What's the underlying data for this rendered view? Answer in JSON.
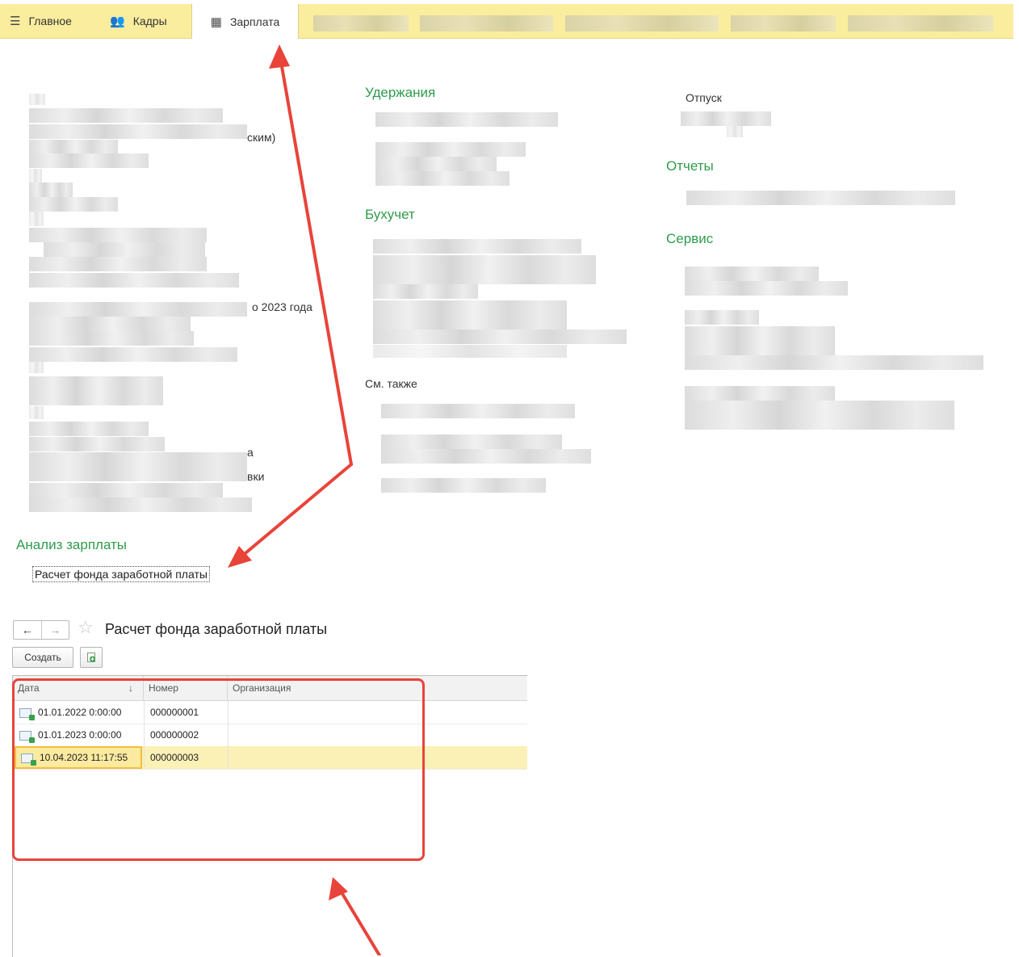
{
  "topbar": {
    "tabs": [
      {
        "label": "Главное",
        "icon": "menu-icon"
      },
      {
        "label": "Кадры",
        "icon": "people-icon"
      },
      {
        "label": "Зарплата",
        "icon": "calculator-icon",
        "active": true
      }
    ]
  },
  "left_fragments": {
    "frag1": "ским)",
    "frag2": "о 2023 года",
    "frag3": "а",
    "frag4": "вки"
  },
  "sections": {
    "deductions": "Удержания",
    "accounting": "Бухучет",
    "see_also": "См. также",
    "vacation": "Отпуск",
    "reports": "Отчеты",
    "service": "Сервис",
    "salary_analysis": "Анализ зарплаты",
    "salary_fund_link": "Расчет фонда заработной платы"
  },
  "form": {
    "title": "Расчет фонда заработной платы",
    "back": "←",
    "forward": "→",
    "create_label": "Создать"
  },
  "table": {
    "columns": [
      "Дата",
      "Номер",
      "Организация"
    ],
    "sort_indicator": "↓",
    "rows": [
      {
        "date": "01.01.2022 0:00:00",
        "number": "000000001",
        "org": ""
      },
      {
        "date": "01.01.2023 0:00:00",
        "number": "000000002",
        "org": ""
      },
      {
        "date": "10.04.2023 11:17:55",
        "number": "000000003",
        "org": "",
        "selected": true
      }
    ]
  },
  "colors": {
    "topbar": "#fbed9e",
    "section_heading": "#2e9c4b",
    "annotation_red": "#e8443a",
    "selected_row": "#fbf0b6"
  }
}
